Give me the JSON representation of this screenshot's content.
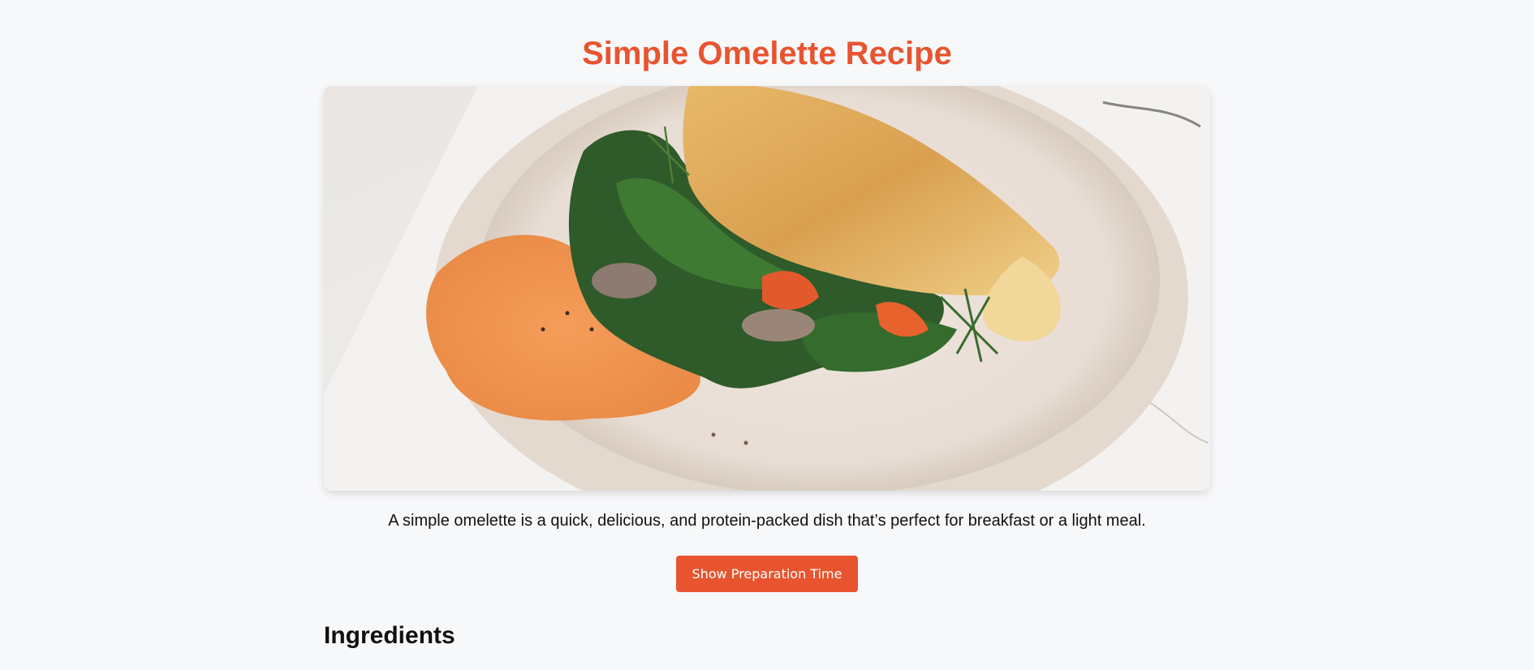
{
  "page": {
    "title": "Simple Omelette Recipe",
    "accent_color": "#e8542f",
    "hero_image": {
      "subject": "folded omelette with spinach, dill, mushrooms and carrot spread on a white plate"
    },
    "description": "A simple omelette is a quick, delicious, and protein-packed dish that’s perfect for breakfast or a light meal.",
    "button_label": "Show Preparation Time",
    "ingredients_heading": "Ingredients"
  }
}
